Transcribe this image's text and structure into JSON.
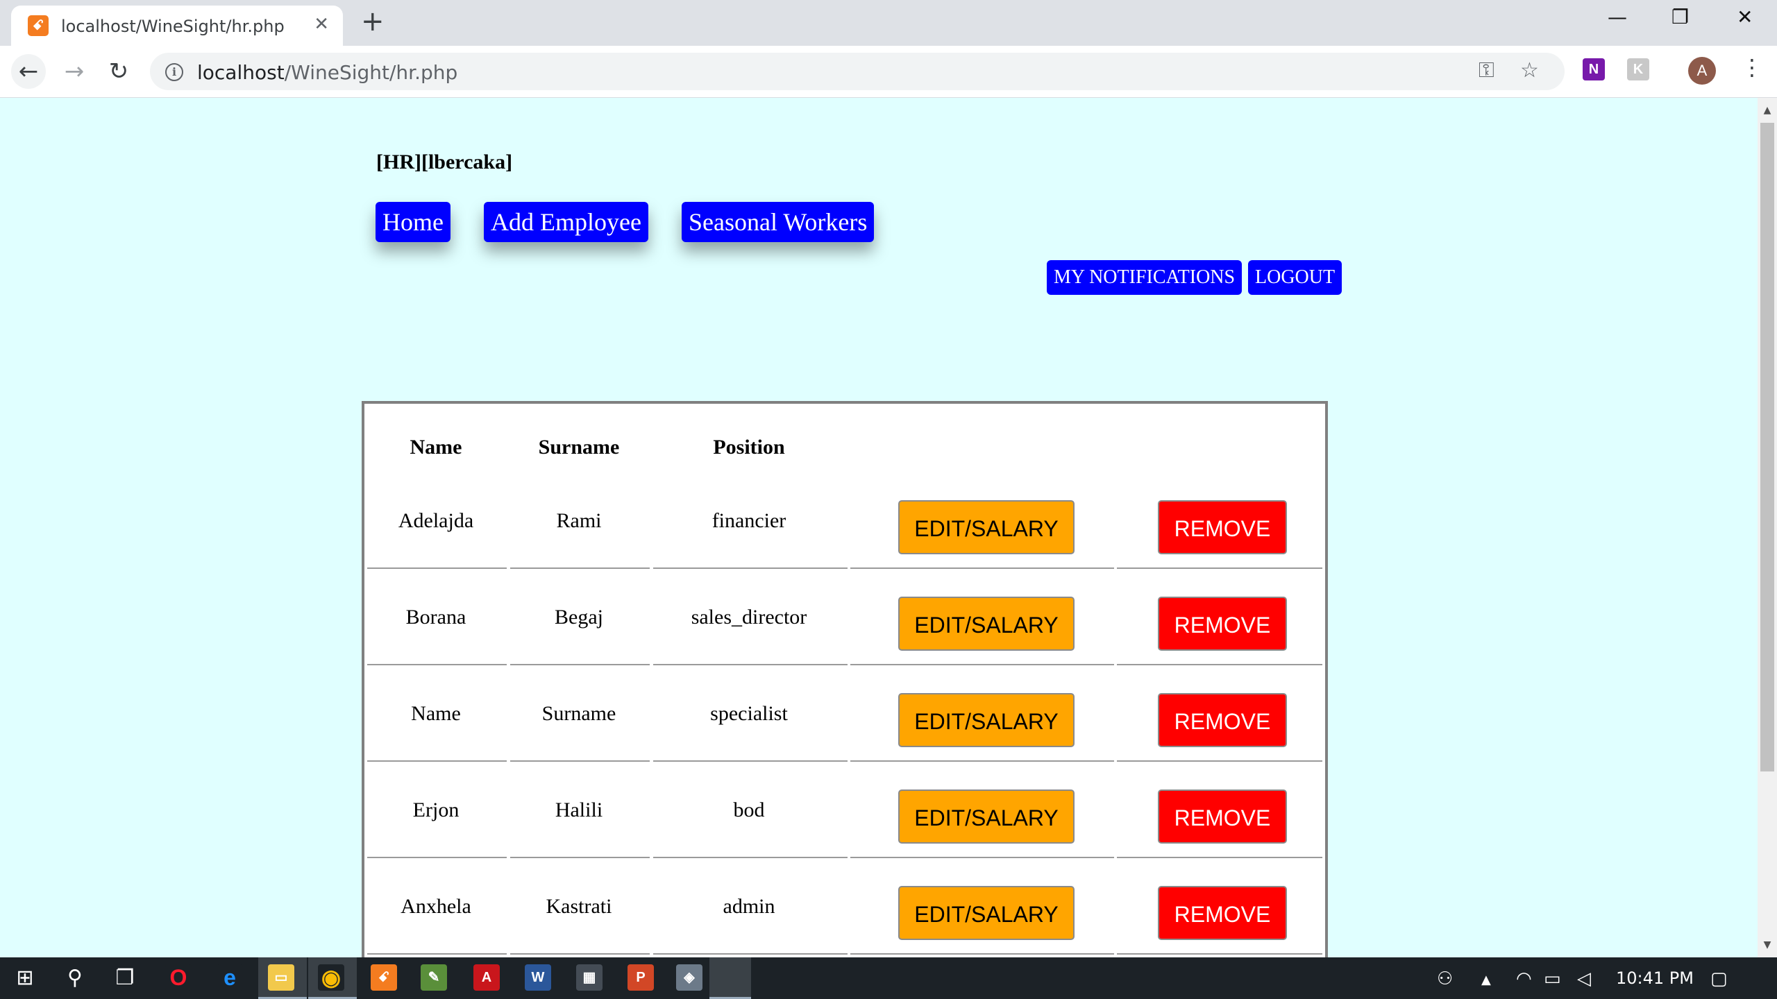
{
  "browser": {
    "tab_title": "localhost/WineSight/hr.php",
    "tab_favicon": "xampp-icon",
    "close_tab": "✕",
    "new_tab": "+",
    "url_host": "localhost",
    "url_path": "/WineSight/hr.php",
    "profile_initial": "A",
    "window": {
      "minimize": "—",
      "restore": "❐",
      "close": "✕"
    }
  },
  "page": {
    "user_tag": "[HR][lbercaka]",
    "nav": {
      "home": "Home",
      "add_employee": "Add Employee",
      "seasonal_workers": "Seasonal Workers"
    },
    "my_notifications": "MY NOTIFICATIONS",
    "logout": "LOGOUT"
  },
  "table": {
    "headers": {
      "name": "Name",
      "surname": "Surname",
      "position": "Position"
    },
    "edit_label": "EDIT/SALARY",
    "remove_label": "REMOVE",
    "rows": [
      {
        "name": "Adelajda",
        "surname": "Rami",
        "position": "financier"
      },
      {
        "name": "Borana",
        "surname": "Begaj",
        "position": "sales_director"
      },
      {
        "name": "Name",
        "surname": "Surname",
        "position": "specialist"
      },
      {
        "name": "Erjon",
        "surname": "Halili",
        "position": "bod"
      },
      {
        "name": "Anxhela",
        "surname": "Kastrati",
        "position": "admin"
      }
    ]
  },
  "taskbar": {
    "time": "10:41 PM"
  },
  "colors": {
    "page_bg": "#e0ffff",
    "nav_button": "#0000ff",
    "edit_button": "#ffa500",
    "remove_button": "#ff0000"
  }
}
